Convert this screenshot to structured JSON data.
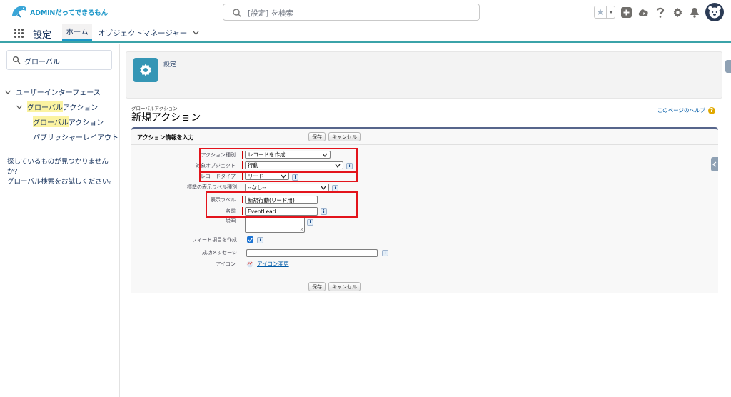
{
  "brand": {
    "logo_text": "ADMINだってできるもん",
    "accent": "#1b96c8",
    "teal": "#3ba3a9"
  },
  "header": {
    "search_placeholder": "[設定] を検索"
  },
  "nav": {
    "app_name": "設定",
    "tabs": [
      {
        "label": "ホーム",
        "active": true
      },
      {
        "label": "オブジェクトマネージャー",
        "active": false
      }
    ]
  },
  "sidebar": {
    "quick_find_value": "グローバル",
    "tree": {
      "ui": "ユーザーインターフェース",
      "ga_highlight": "グローバル",
      "ga_rest": "アクション",
      "gaa_highlight": "グローバル",
      "gaa_rest": "アクション",
      "publisher": "パブリッシャーレイアウト"
    },
    "note_line1": "探しているものが見つかりませんか?",
    "note_line2": "グローバル検索をお試しください。"
  },
  "main": {
    "setup_title": "設定",
    "page_subtitle": "グローバルアクション",
    "page_title": "新規アクション",
    "help_link": "このページのヘルプ",
    "panel_title": "アクション情報を入力",
    "buttons": {
      "save": "保存",
      "cancel": "キャンセル"
    },
    "fields": {
      "action_type": {
        "label": "アクション種別",
        "value": "レコードを作成"
      },
      "target_object": {
        "label": "対象オブジェクト",
        "value": "行動"
      },
      "record_type": {
        "label": "レコードタイプ",
        "value": "リード"
      },
      "std_label_type": {
        "label": "標準の表示ラベル種別",
        "value": "--なし--"
      },
      "display_label": {
        "label": "表示ラベル",
        "value": "新規行動(リード用)"
      },
      "name": {
        "label": "名前",
        "value": "EventLead"
      },
      "description": {
        "label": "説明",
        "value": ""
      },
      "feed_item": {
        "label": "フィード項目を作成",
        "checked": true
      },
      "success_message": {
        "label": "成功メッセージ",
        "value": ""
      },
      "icon": {
        "label": "アイコン",
        "link": "アイコン変更"
      }
    }
  }
}
